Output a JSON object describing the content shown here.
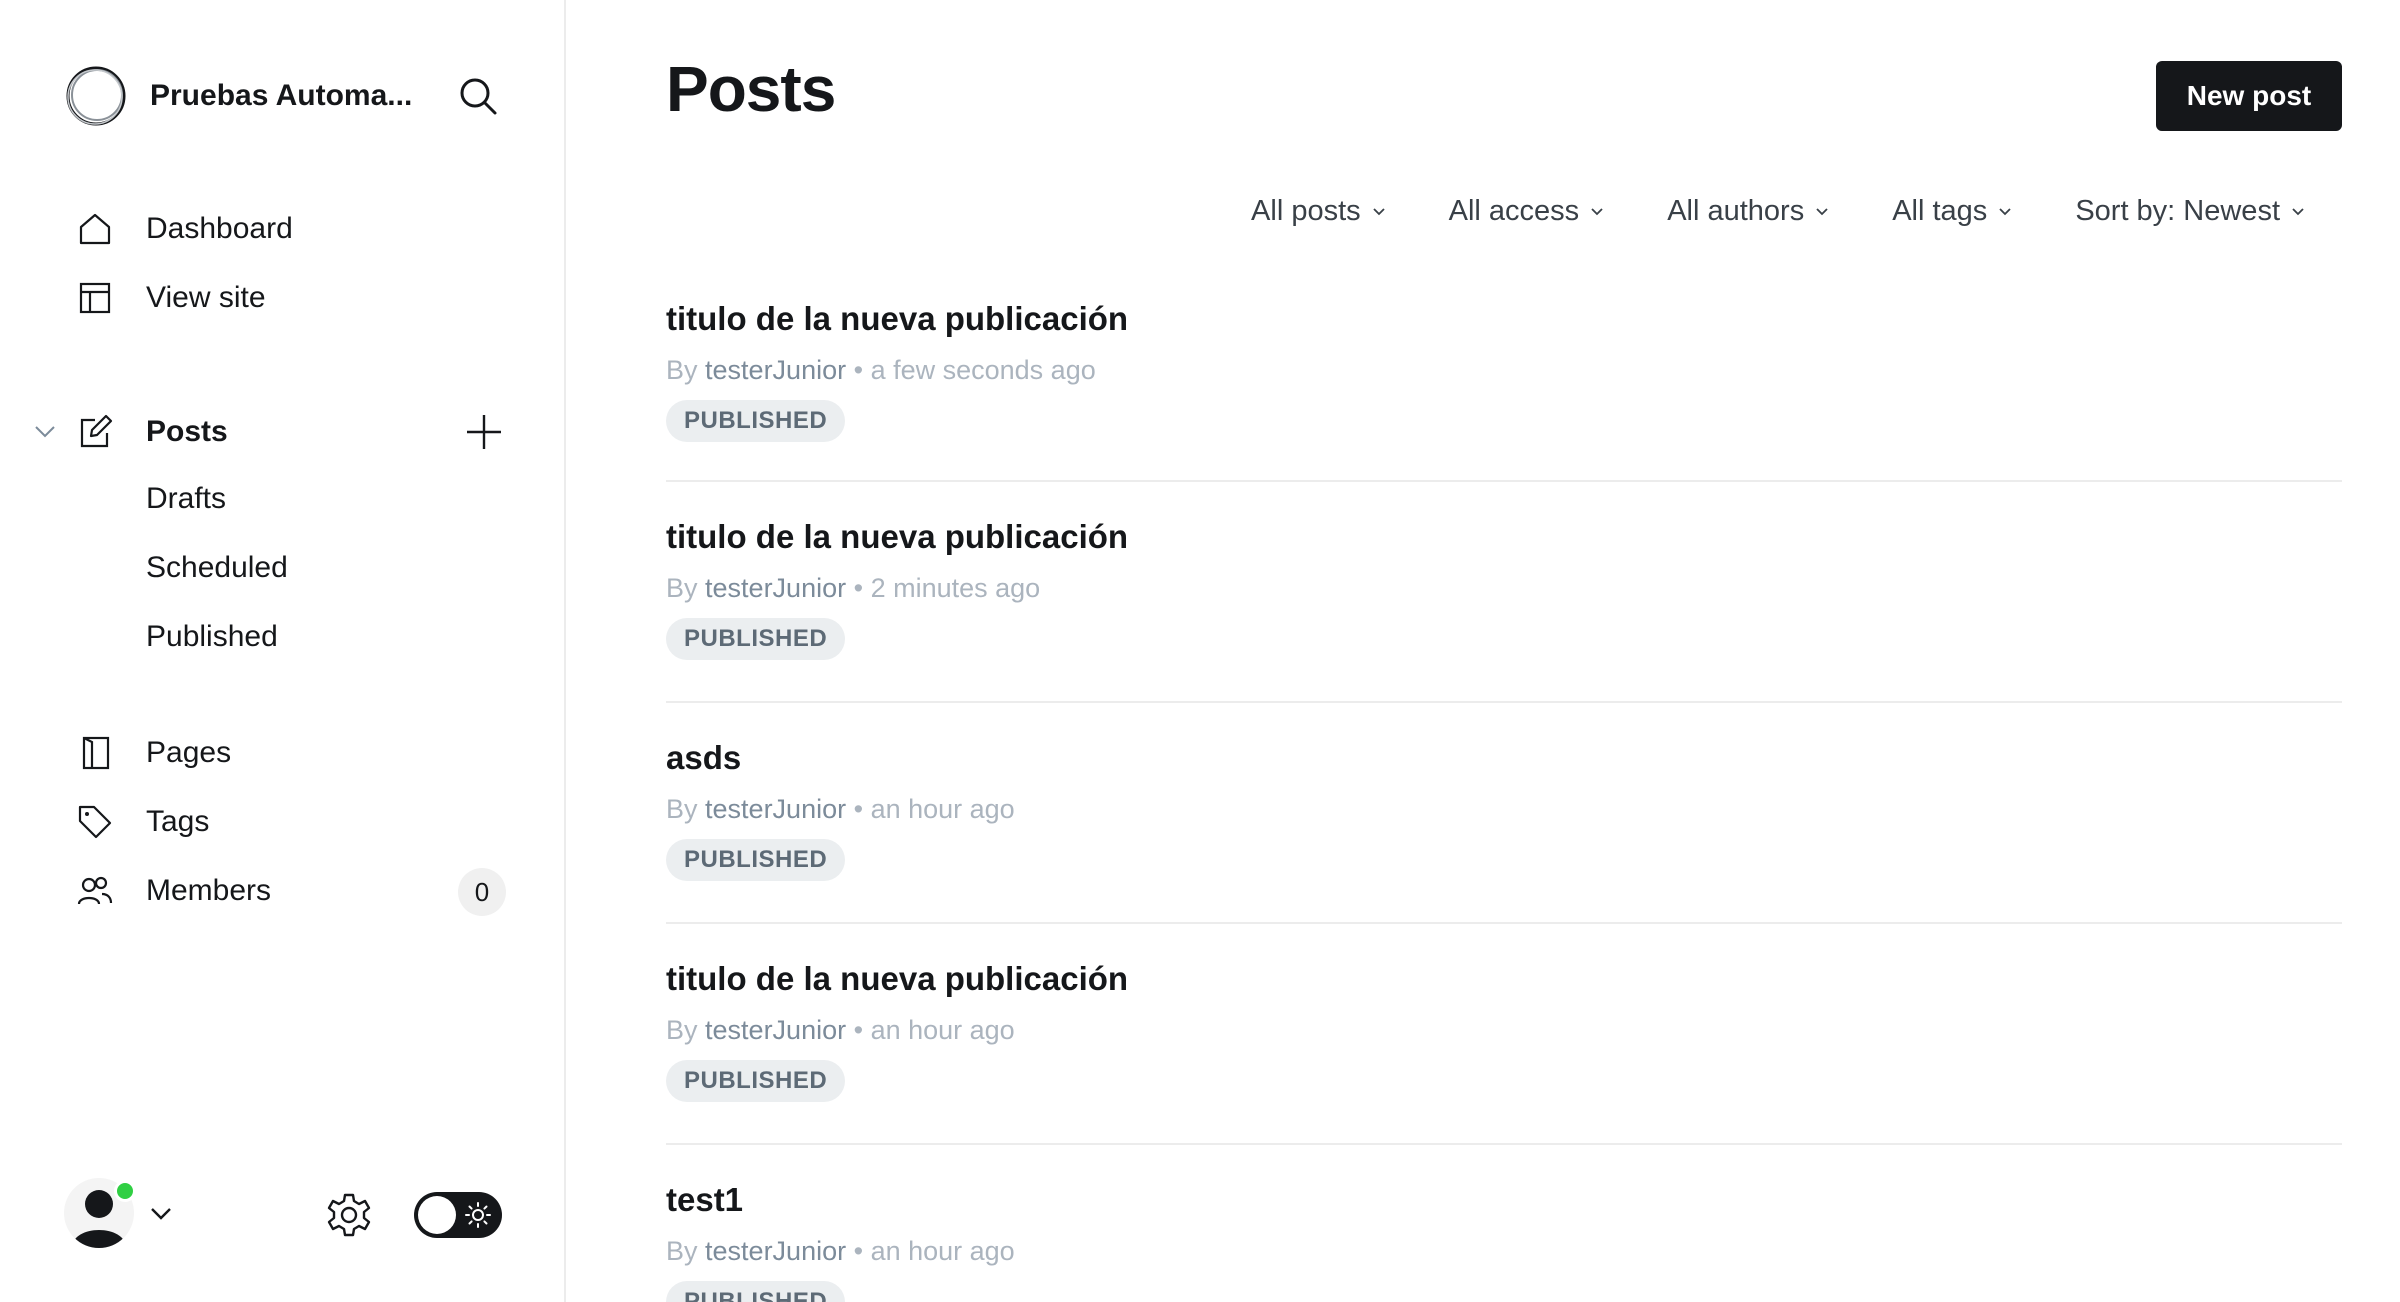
{
  "sidebar": {
    "site_name": "Pruebas Automa...",
    "nav": {
      "dashboard": "Dashboard",
      "view_site": "View site",
      "posts": "Posts",
      "drafts": "Drafts",
      "scheduled": "Scheduled",
      "published": "Published",
      "pages": "Pages",
      "tags": "Tags",
      "members": "Members",
      "members_count": "0"
    },
    "icons": [
      "ghost-logo-icon",
      "search-icon",
      "home-icon",
      "layout-icon",
      "edit-icon",
      "plus-icon",
      "page-icon",
      "tag-icon",
      "members-icon",
      "gear-icon",
      "sun-icon"
    ]
  },
  "main": {
    "title": "Posts",
    "new_post": "New post",
    "filters": {
      "type": "All posts",
      "access": "All access",
      "authors": "All authors",
      "tags": "All tags",
      "sort": "Sort by: Newest"
    },
    "posts": [
      {
        "title": "titulo de la nueva publicación",
        "by": "By",
        "author": "testerJunior",
        "time": "a few seconds ago",
        "status": "PUBLISHED"
      },
      {
        "title": "titulo de la nueva publicación",
        "by": "By",
        "author": "testerJunior",
        "time": "2 minutes ago",
        "status": "PUBLISHED"
      },
      {
        "title": "asds",
        "by": "By",
        "author": "testerJunior",
        "time": "an hour ago",
        "status": "PUBLISHED"
      },
      {
        "title": "titulo de la nueva publicación",
        "by": "By",
        "author": "testerJunior",
        "time": "an hour ago",
        "status": "PUBLISHED"
      },
      {
        "title": "test1",
        "by": "By",
        "author": "testerJunior",
        "time": "an hour ago",
        "status": "PUBLISHED"
      }
    ]
  },
  "colors": {
    "primary": "#15171a",
    "online": "#30cf43",
    "muted": "#abb4be",
    "badge_bg": "#ebeef0"
  }
}
